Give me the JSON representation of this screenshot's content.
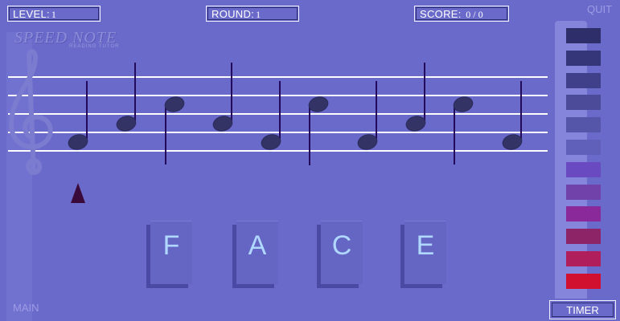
{
  "hud": {
    "level_label": "LEVEL:",
    "level_value": "1",
    "round_label": "ROUND:",
    "round_value": "1",
    "score_label": "SCORE:",
    "score_value": "0 / 0"
  },
  "logo": {
    "title": "SPEED NOTE",
    "subtitle": "READING TUTOR"
  },
  "links": {
    "quit": "QUIT",
    "main": "MAIN"
  },
  "timer_label": "TIMER",
  "timer_colors": [
    "#2e2e6a",
    "#35357a",
    "#40408a",
    "#4b4b9a",
    "#5555aa",
    "#6060ba",
    "#6a4ac0",
    "#7042aa",
    "#8a2a9a",
    "#8e2468",
    "#b01f5c",
    "#d0102e"
  ],
  "answer_keys": [
    "F",
    "A",
    "C",
    "E"
  ],
  "staff_note_icon": "treble-clef-icon",
  "pointer_icon": "red-triangle-pointer-icon",
  "colors": {
    "background": "#6a6acb",
    "note": "#333366",
    "stem": "#230a5a",
    "staff_line": "#ffffff"
  }
}
